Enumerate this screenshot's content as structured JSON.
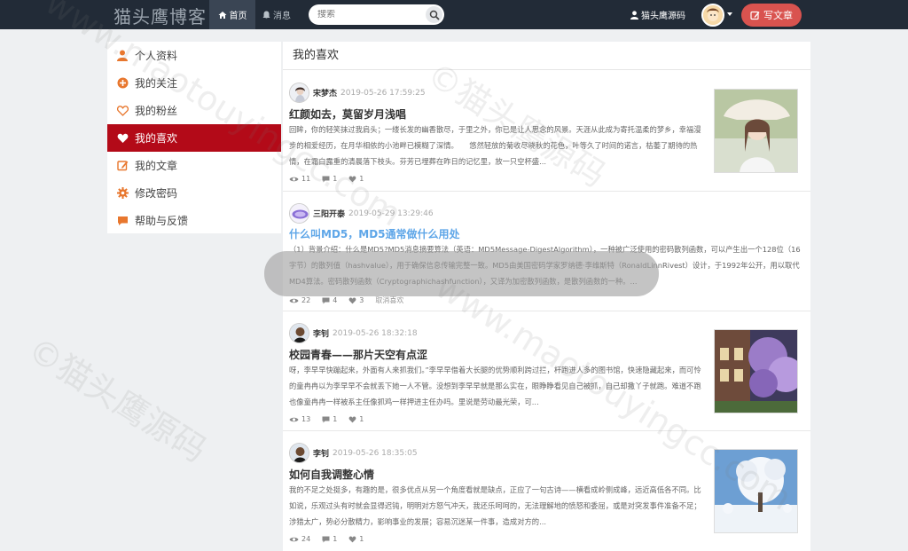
{
  "navbar": {
    "brand": "猫头鹰博客",
    "home_label": "首页",
    "messages_label": "消息",
    "search_placeholder": "搜索",
    "user_name": "猫头鹰源码",
    "write_label": "写文章"
  },
  "sidebar": {
    "items": [
      {
        "label": "个人资料",
        "icon": "user-icon"
      },
      {
        "label": "我的关注",
        "icon": "plus-circle-icon"
      },
      {
        "label": "我的粉丝",
        "icon": "heart-outline-icon"
      },
      {
        "label": "我的喜欢",
        "icon": "heart-icon"
      },
      {
        "label": "我的文章",
        "icon": "edit-icon"
      },
      {
        "label": "修改密码",
        "icon": "gear-icon"
      },
      {
        "label": "帮助与反馈",
        "icon": "comment-icon"
      }
    ],
    "active_index": 3
  },
  "main": {
    "title": "我的喜欢",
    "articles": [
      {
        "author": "宋梦杰",
        "time": "2019-05-26 17:59:25",
        "title": "红颜如去，莫留岁月浅唱",
        "summary": "回眸，你的轻笑抹过我肩头；一缕长发的幽香散尽，于里之外，你已是让人思念的风景。天涯从此成为寄托温柔的梦乡，幸福漫步的相爱经历，在月华相依的小池畔已模糊了深情。　　悠然轻放的菊收尽晓秋的花色，叶等久了时间的诺言，枯萎了期待的热情，在霜白露重的清晨落下枝头。芬芳已埋葬在昨日的记忆里，放一只空杯盛...",
        "views": "11",
        "comments": "1",
        "likes": "1"
      },
      {
        "author": "三阳开泰",
        "time": "2019-05-29 13:29:46",
        "title": "什么叫MD5，MD5通常做什么用处",
        "summary": "（1）背景介绍：什么是MD5?MD5消息摘要算法（英语：MD5Message-DigestAlgorithm），一种被广泛使用的密码散列函数，可以产生出一个128位（16字节）的散列值（hashvalue），用于确保信息传输完整一致。MD5由美国密码学家罗纳德·李维斯特（RonaldLinnRivest）设计，于1992年公开，用以取代MD4算法。密码散列函数（Cryptographichashfunction），又译为加密散列函数，是散列函数的一种。...",
        "views": "22",
        "comments": "4",
        "likes": "3",
        "cancel_label": "取消喜欢"
      },
      {
        "author": "李钊",
        "time": "2019-05-26 18:32:18",
        "title": "校园青春——那片天空有点涩",
        "summary": "呀，李早早快蹦起来，外面有人来抓我们。”李早早借着大长腿的优势顺利跨过拦，杆跑进人多的图书馆，快速隐藏起来，而可怜的童冉冉以为李早早不会就丢下她一人不管。没想到李早早就是那么实在，眼睁睁看见自己被抓，自己却撒丫子就跑。难道不跑也像童冉冉一样被系主任像抓鸡一样押进主任办吗。里说是劳动最光荣，可...",
        "views": "13",
        "comments": "1",
        "likes": "1"
      },
      {
        "author": "李钊",
        "time": "2019-05-26 18:35:05",
        "title": "如何自我调整心情",
        "summary": "我的不足之处挺多，有趣的是，很多优点从另一个角度看就是缺点，正应了一句古诗——横看成岭侧成峰，远近高低各不同。比如说，乐观过头有时就会显得迟钝，明明对方怒气冲天，我还乐呵呵的，无法理解地的愤怒和委屈，或是对突发事件准备不足；涉猎太广，势必分散精力，影响事业的发展；容易沉迷某一件事，造成对方的...",
        "views": "24",
        "comments": "1",
        "likes": "1"
      }
    ]
  },
  "watermark": {
    "cn": "©猫头鹰源码",
    "en": "www.maotouyingcc.com"
  }
}
